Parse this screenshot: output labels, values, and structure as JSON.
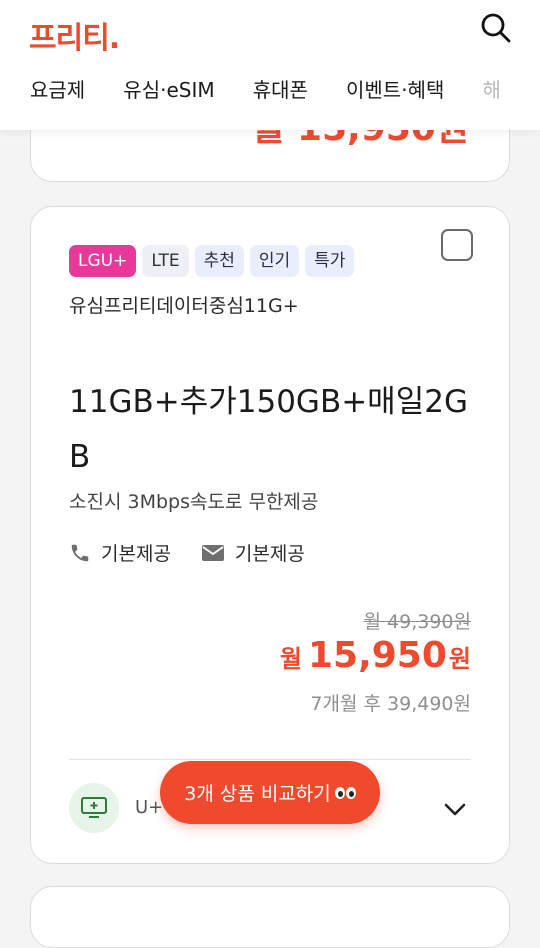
{
  "header": {
    "logo_text": "프리티.",
    "nav": [
      "요금제",
      "유심·eSIM",
      "휴대폰",
      "이벤트·혜택",
      "해"
    ]
  },
  "previous_card": {
    "price_partial": "월 15,950원"
  },
  "plan": {
    "badges": {
      "carrier": "LGU+",
      "network": "LTE",
      "tags": [
        "추천",
        "인기",
        "특가"
      ]
    },
    "name": "유심프리티데이터중심11G+",
    "data": "11GB+추가150GB+매일2GB",
    "speed": "소진시 3Mbps속도로 무한제공",
    "voice": "기본제공",
    "sms": "기본제공",
    "original_price": "월 49,390원",
    "sale_prefix": "월",
    "sale_amount": "15,950",
    "sale_unit": "원",
    "after_price": "7개월 후 39,490원",
    "bottom_text": "U+"
  },
  "compare_button": {
    "label": "3개 상품 비교하기"
  },
  "colors": {
    "brand": "#ef4a2e",
    "carrier_badge": "#e8399b"
  }
}
